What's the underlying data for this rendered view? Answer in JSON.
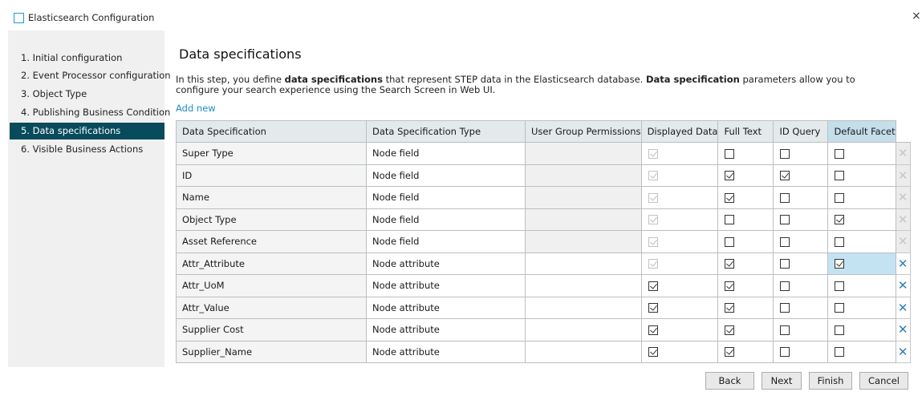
{
  "window": {
    "title": "Elasticsearch Configuration",
    "close_icon": "×"
  },
  "sidebar": {
    "items": [
      {
        "label": "1. Initial configuration"
      },
      {
        "label": "2. Event Processor configuration"
      },
      {
        "label": "3. Object Type"
      },
      {
        "label": "4. Publishing Business Condition"
      },
      {
        "label": "5. Data specifications"
      },
      {
        "label": "6. Visible Business Actions"
      }
    ],
    "active_index": 4
  },
  "main": {
    "title": "Data specifications",
    "description": {
      "p1": "In this step, you define ",
      "b1": "data specifications",
      "p2": " that represent STEP data in the Elasticsearch database. ",
      "b2": "Data specification",
      "p3": " parameters allow you to configure your search experience using the Search Screen in Web UI."
    },
    "add_new": "Add new"
  },
  "table": {
    "columns": [
      "Data Specification",
      "Data Specification Type",
      "User Group Permissions",
      "Displayed Data",
      "Full Text",
      "ID Query",
      "Default Facet"
    ],
    "rows": [
      {
        "name": "Super Type",
        "type": "Node field",
        "displayed": true,
        "displayed_disabled": true,
        "full_text": false,
        "id_query": false,
        "default_facet": false
      },
      {
        "name": "ID",
        "type": "Node field",
        "displayed": true,
        "displayed_disabled": true,
        "full_text": true,
        "id_query": true,
        "default_facet": false
      },
      {
        "name": "Name",
        "type": "Node field",
        "displayed": true,
        "displayed_disabled": true,
        "full_text": true,
        "id_query": false,
        "default_facet": false
      },
      {
        "name": "Object Type",
        "type": "Node field",
        "displayed": true,
        "displayed_disabled": true,
        "full_text": false,
        "id_query": false,
        "default_facet": true
      },
      {
        "name": "Asset Reference",
        "type": "Node field",
        "displayed": true,
        "displayed_disabled": true,
        "full_text": false,
        "id_query": false,
        "default_facet": false
      },
      {
        "name": "Attr_Attribute",
        "type": "Node attribute",
        "displayed": true,
        "displayed_disabled": true,
        "full_text": true,
        "id_query": false,
        "default_facet": true
      },
      {
        "name": "Attr_UoM",
        "type": "Node attribute",
        "displayed": true,
        "displayed_disabled": false,
        "full_text": true,
        "id_query": false,
        "default_facet": false
      },
      {
        "name": "Attr_Value",
        "type": "Node attribute",
        "displayed": true,
        "displayed_disabled": false,
        "full_text": true,
        "id_query": false,
        "default_facet": false
      },
      {
        "name": "Supplier Cost",
        "type": "Node attribute",
        "displayed": true,
        "displayed_disabled": false,
        "full_text": true,
        "id_query": false,
        "default_facet": false
      },
      {
        "name": "Supplier_Name",
        "type": "Node attribute",
        "displayed": true,
        "displayed_disabled": false,
        "full_text": true,
        "id_query": false,
        "default_facet": false
      }
    ],
    "delete_icon": "✕"
  },
  "buttons": {
    "back": "Back",
    "next": "Next",
    "finish": "Finish",
    "cancel": "Cancel"
  },
  "colors": {
    "accent": "#074b5c",
    "link": "#1f8fc8",
    "header_highlight": "#c4dfe9",
    "delete_enabled": "#2f7fb5"
  }
}
